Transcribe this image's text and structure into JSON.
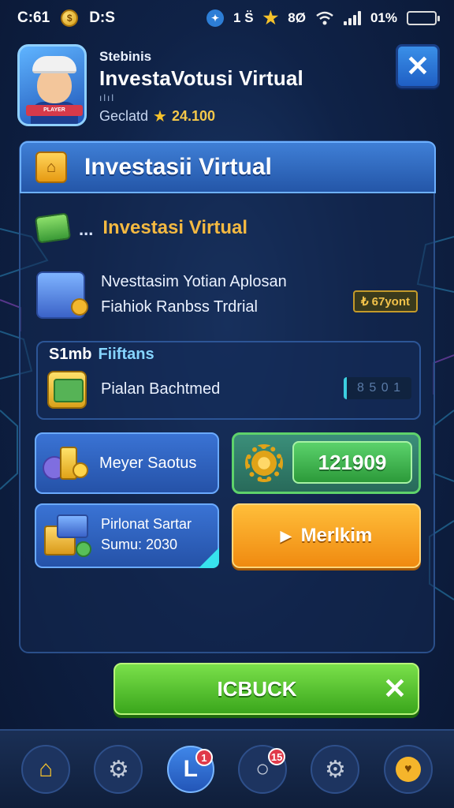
{
  "status_bar": {
    "time": "C:61",
    "carrier": "D:S",
    "coin_glyph": "$",
    "indicator": "1 S̈",
    "level": "8Ø",
    "battery_text": "01%"
  },
  "header": {
    "small_title": "Stebinis",
    "title": "InvestaVotusi Virtual",
    "bars": "ılıl",
    "rank_label": "Geclatd",
    "score": "24.100",
    "avatar_ribbon": "PLAYER"
  },
  "panel": {
    "title": "Investasii Virtual",
    "row1_dots": "...",
    "row1_label": "Investasi Virtual",
    "row2_line1": "Nvesttasim Yotian Aplosan",
    "row2_line2": "Fiahiok Ranbss Trdrial",
    "row2_tag": "₺ 67yont",
    "card1_title": "S1mb",
    "card1_title_accent": "Fiiftans",
    "card1_sub": "Pialan Bachtmed",
    "card1_value": "8 5 0 1",
    "tile_a_label": "Meyer Saotus",
    "tile_b_value": "121909",
    "tile_c_line1": "Pirlonat Sartar",
    "tile_c_line2": "Sumu: 2030",
    "tile_d_label": "Merlkim",
    "tile_d_icon": "▶"
  },
  "big_button": {
    "label": "ICBUCK",
    "close_glyph": "✕"
  },
  "nav": {
    "active_glyph": "L",
    "badge_active": "1",
    "badge_chat": "15",
    "home_glyph": "⌂",
    "gear_glyph": "⚙",
    "chat_glyph": "○",
    "heart_glyph": "♥"
  },
  "colors": {
    "background": "#0f2247",
    "accent_blue": "#2456a8",
    "accent_gold": "#f4b941",
    "accent_green": "#3aa61c",
    "accent_orange": "#f08a10"
  },
  "icons": [
    "coin-icon",
    "shield-icon",
    "star-icon",
    "wifi-icon",
    "signal-icon",
    "battery-icon",
    "close-icon",
    "house-icon",
    "money-icon",
    "machine-icon",
    "bank-icon",
    "coins-icon",
    "gear-icon",
    "crate-icon",
    "play-icon",
    "home-icon",
    "settings-icon",
    "chat-icon",
    "heart-icon"
  ]
}
